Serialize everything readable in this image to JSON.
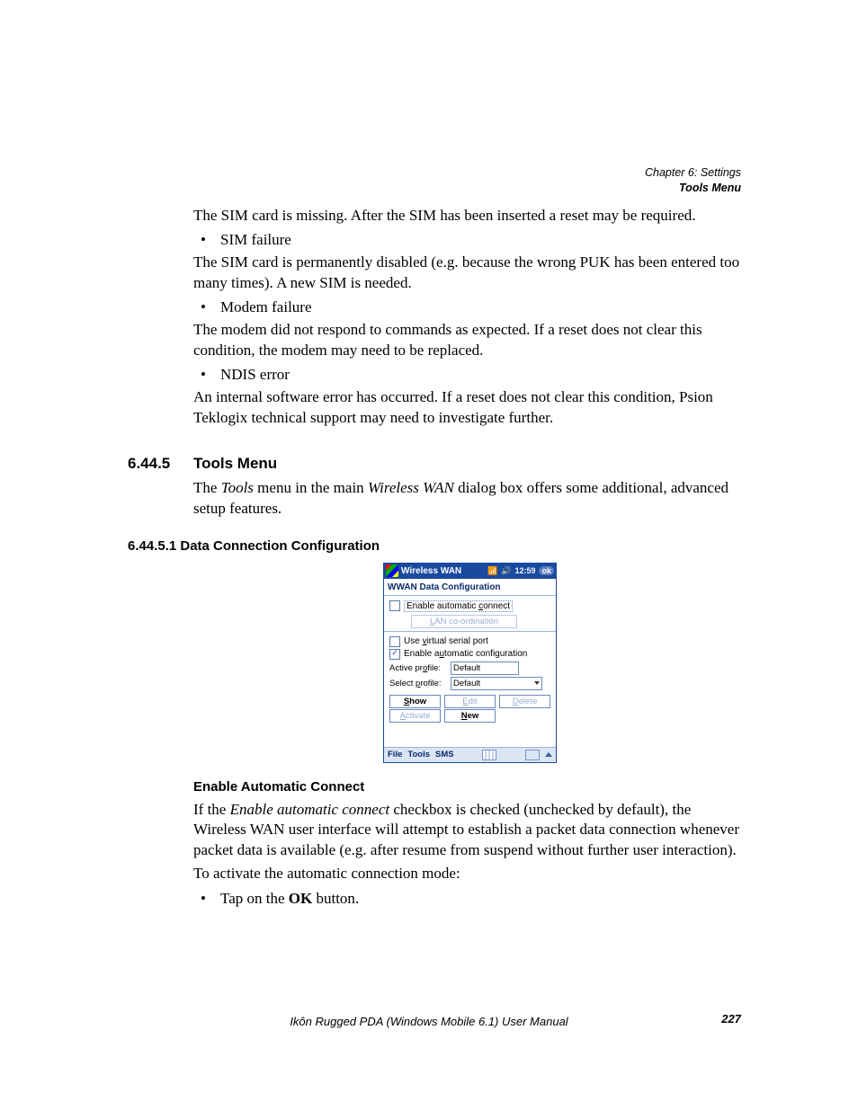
{
  "header": {
    "chapter": "Chapter 6:  Settings",
    "section": "Tools Menu"
  },
  "body": {
    "p1": "The SIM card is missing. After the SIM has been inserted a reset may be required.",
    "li1": "SIM failure",
    "p2": "The SIM card is permanently disabled (e.g. because the wrong PUK has been entered too many times). A new SIM is needed.",
    "li2": "Modem failure",
    "p3": "The modem did not respond to commands as expected. If a reset does not clear this condition, the modem may need to be replaced.",
    "li3": "NDIS error",
    "p4": "An internal software error has occurred. If a reset does not clear this condition, Psion Teklogix technical support may need to investigate further."
  },
  "sec": {
    "num": "6.44.5",
    "title": "Tools Menu",
    "para_a": "The ",
    "para_i1": "Tools",
    "para_b": " menu in the main ",
    "para_i2": "Wireless WAN",
    "para_c": " dialog box offers some additional, advanced setup features."
  },
  "subsec": {
    "numtitle": "6.44.5.1 Data Connection Configuration"
  },
  "pda": {
    "title": "Wireless WAN",
    "time": "12:59",
    "ok": "ok",
    "heading": "WWAN Data Configuration",
    "enable_auto_connect_pre": "Enable automatic ",
    "enable_auto_connect_u": "c",
    "enable_auto_connect_post": "onnect",
    "lan_pre": "",
    "lan_u": "L",
    "lan_post": "AN co-ordination",
    "use_vsp_pre": "Use ",
    "use_vsp_u": "v",
    "use_vsp_post": "irtual serial port",
    "enable_auto_conf_pre": "Enable a",
    "enable_auto_conf_u": "u",
    "enable_auto_conf_post": "tomatic configuration",
    "active_label_pre": "Active pr",
    "active_label_u": "o",
    "active_label_post": "file:",
    "active_value": "Default",
    "select_label_pre": "Select ",
    "select_label_u": "p",
    "select_label_post": "rofile:",
    "select_value": "Default",
    "btn_show_u": "S",
    "btn_show_post": "how",
    "btn_edit_u": "E",
    "btn_edit_post": "dit",
    "btn_delete_u": "D",
    "btn_delete_post": "elete",
    "btn_activate_u": "A",
    "btn_activate_post": "ctivate",
    "btn_new_u": "N",
    "btn_new_post": "ew",
    "menu_file": "File",
    "menu_tools": "Tools",
    "menu_sms": "SMS"
  },
  "sub2": {
    "title": "Enable Automatic Connect",
    "p1_a": "If the ",
    "p1_i": "Enable automatic connect",
    "p1_b": " checkbox is checked (unchecked by default), the Wireless WAN user interface will attempt to establish a packet data connection whenever packet data is available (e.g. after resume from suspend without further user interaction).",
    "p2": "To activate the automatic connection mode:",
    "li_pre": "Tap on the ",
    "li_bold": "OK",
    "li_post": " button."
  },
  "footer": {
    "text": "Ikôn Rugged PDA (Windows Mobile 6.1) User Manual",
    "page": "227"
  }
}
